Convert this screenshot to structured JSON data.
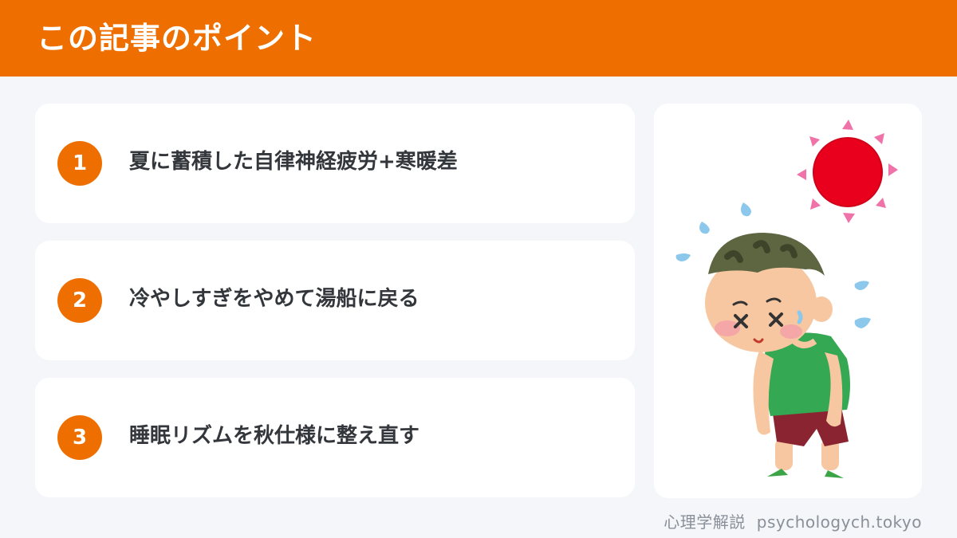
{
  "header": {
    "title": "この記事のポイント"
  },
  "points": [
    {
      "number": "1",
      "text": "夏に蓄積した自律神経疲労+寒暖差"
    },
    {
      "number": "2",
      "text": "冷やしすぎをやめて湯船に戻る"
    },
    {
      "number": "3",
      "text": "睡眠リズムを秋仕様に整え直す"
    }
  ],
  "footer": {
    "site_name": "心理学解説",
    "domain": "psychologych.tokyo"
  },
  "illustration": {
    "icon": "tired-boy-in-heat-illustration"
  },
  "colors": {
    "accent": "#ee6f00",
    "background": "#f4f6f9",
    "card": "#ffffff",
    "text": "#33363b",
    "muted": "#8a9099"
  }
}
